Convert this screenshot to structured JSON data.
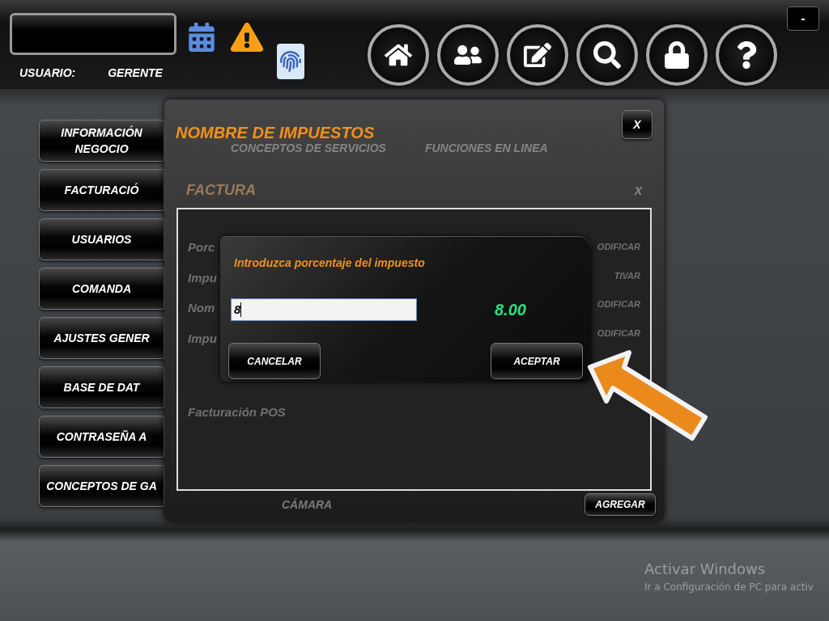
{
  "header": {
    "user_label": "USUARIO:",
    "user_name": "GERENTE",
    "nav_buttons": [
      {
        "kind": "home"
      },
      {
        "kind": "users"
      },
      {
        "kind": "notes"
      },
      {
        "kind": "search"
      },
      {
        "kind": "lock"
      },
      {
        "kind": "help"
      }
    ],
    "minimize": "-"
  },
  "sidebar": {
    "items": [
      {
        "lines": [
          "INFORMACIÓN",
          "NEGOCIO"
        ]
      },
      {
        "lines": [
          "FACTURACIÓ"
        ]
      },
      {
        "lines": [
          "USUARIOS"
        ]
      },
      {
        "lines": [
          "COMANDA"
        ]
      },
      {
        "lines": [
          "AJUSTES GENER"
        ]
      },
      {
        "lines": [
          "BASE DE DAT"
        ]
      },
      {
        "lines": [
          "CONTRASEÑA A"
        ]
      },
      {
        "lines": [
          "CONCEPTOS DE GA"
        ]
      }
    ]
  },
  "window": {
    "title": "NOMBRE DE IMPUESTOS",
    "close": "X",
    "tabs": [
      "CONCEPTOS DE SERVICIOS",
      "FUNCIONES EN LINEA"
    ],
    "section": "FACTURA",
    "section_close": "X",
    "rows": [
      {
        "label": "Porc",
        "action": "ODIFICAR"
      },
      {
        "label": "Impu",
        "action": "TIVAR"
      },
      {
        "label": "Nom",
        "action": "ODIFICAR"
      },
      {
        "label": "Impu",
        "action": "ODIFICAR"
      }
    ],
    "footer_item": "Facturación POS",
    "bottom_tab": "CÁMARA",
    "add_button": "AGREGAR"
  },
  "prompt": {
    "title": "Introduzca porcentaje del impuesto",
    "value": "8",
    "result": "8.00",
    "cancel": "CANCELAR",
    "accept": "ACEPTAR"
  },
  "activation_notice": {
    "title": "Activar Windows",
    "subtitle": "Ir a Configuración de PC para activ"
  }
}
